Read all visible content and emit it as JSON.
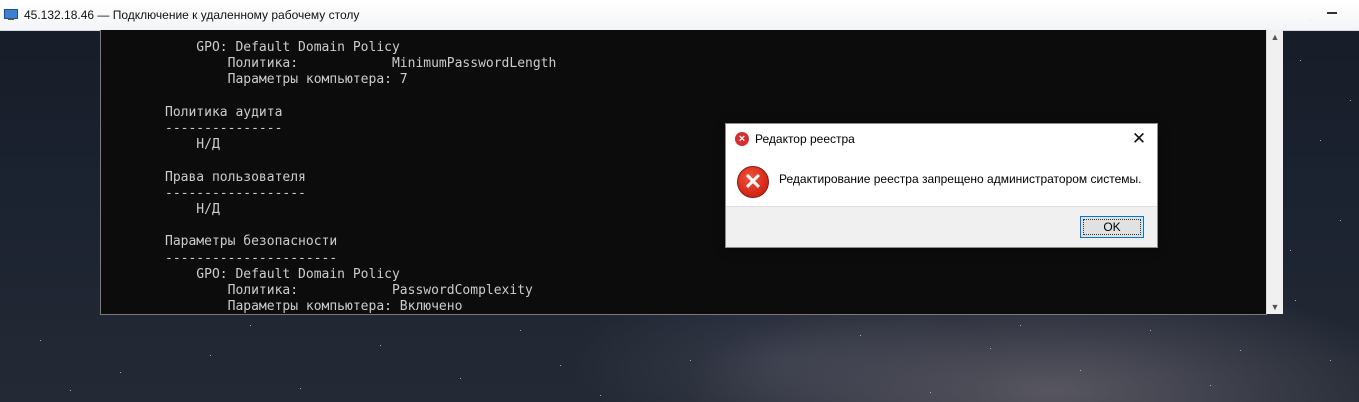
{
  "rdp_window": {
    "title": "45.132.18.46 — Подключение к удаленному рабочему столу",
    "icon": "remote-desktop-icon"
  },
  "console": {
    "lines": [
      "    GPO: Default Domain Policy",
      "        Политика:            MinimumPasswordLength",
      "        Параметры компьютера: 7",
      "",
      "Политика аудита",
      "---------------",
      "    Н/Д",
      "",
      "Права пользователя",
      "------------------",
      "    Н/Д",
      "",
      "Параметры безопасности",
      "----------------------",
      "    GPO: Default Domain Policy",
      "        Политика:            PasswordComplexity",
      "        Параметры компьютера: Включено"
    ]
  },
  "dialog": {
    "title": "Редактор реестра",
    "message": "Редактирование реестра запрещено администратором системы.",
    "ok_label": "OK",
    "close_glyph": "✕",
    "error_glyph": "✕"
  },
  "colors": {
    "console_bg": "#0c0c0c",
    "console_text": "#cccccc",
    "error_red": "#d72b1a",
    "button_focus": "#0078d7"
  }
}
